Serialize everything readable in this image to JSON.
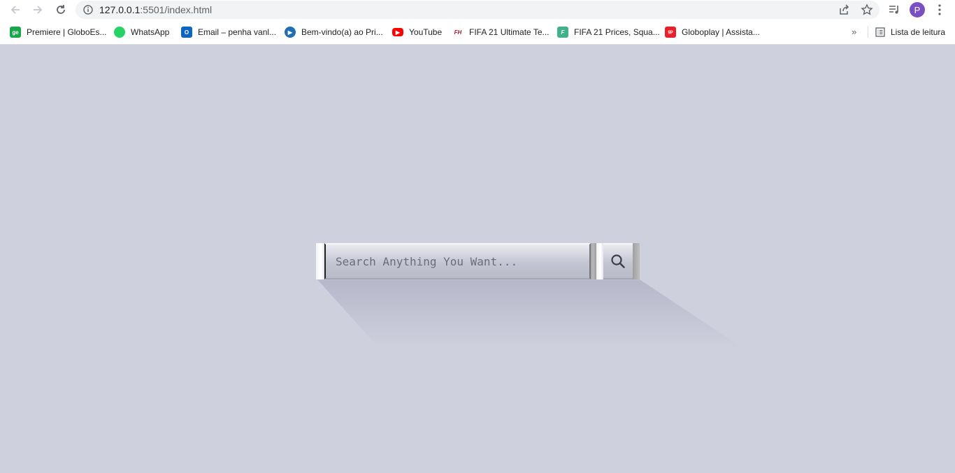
{
  "browser": {
    "url_host": "127.0.0.1",
    "url_rest": ":5501/index.html",
    "profile_initial": "P"
  },
  "bookmarks": [
    {
      "label": "Premiere | GloboEs...",
      "icon": "ge-icon",
      "color": "#1aa54a",
      "glyph": "ge"
    },
    {
      "label": "WhatsApp",
      "icon": "whatsapp-icon",
      "color": "#25d366",
      "glyph": ""
    },
    {
      "label": "Email – penha vanl...",
      "icon": "outlook-icon",
      "color": "#0a66c2",
      "glyph": "O"
    },
    {
      "label": "Bem-vindo(a) ao Pri...",
      "icon": "prime-video-icon",
      "color": "#1f6fb2",
      "glyph": "▶"
    },
    {
      "label": "YouTube",
      "icon": "youtube-icon",
      "color": "#ff0000",
      "glyph": "▶"
    },
    {
      "label": "FIFA 21 Ultimate Te...",
      "icon": "futhead-icon",
      "color": "#b3162b",
      "glyph": "FH"
    },
    {
      "label": "FIFA 21 Prices, Squa...",
      "icon": "futbin-icon",
      "color": "#3fb28a",
      "glyph": "F"
    },
    {
      "label": "Globoplay | Assista...",
      "icon": "globoplay-icon",
      "color": "#e8202c",
      "glyph": "gp"
    }
  ],
  "reading_list_label": "Lista de leitura",
  "search": {
    "placeholder": "Search Anything You Want..."
  }
}
